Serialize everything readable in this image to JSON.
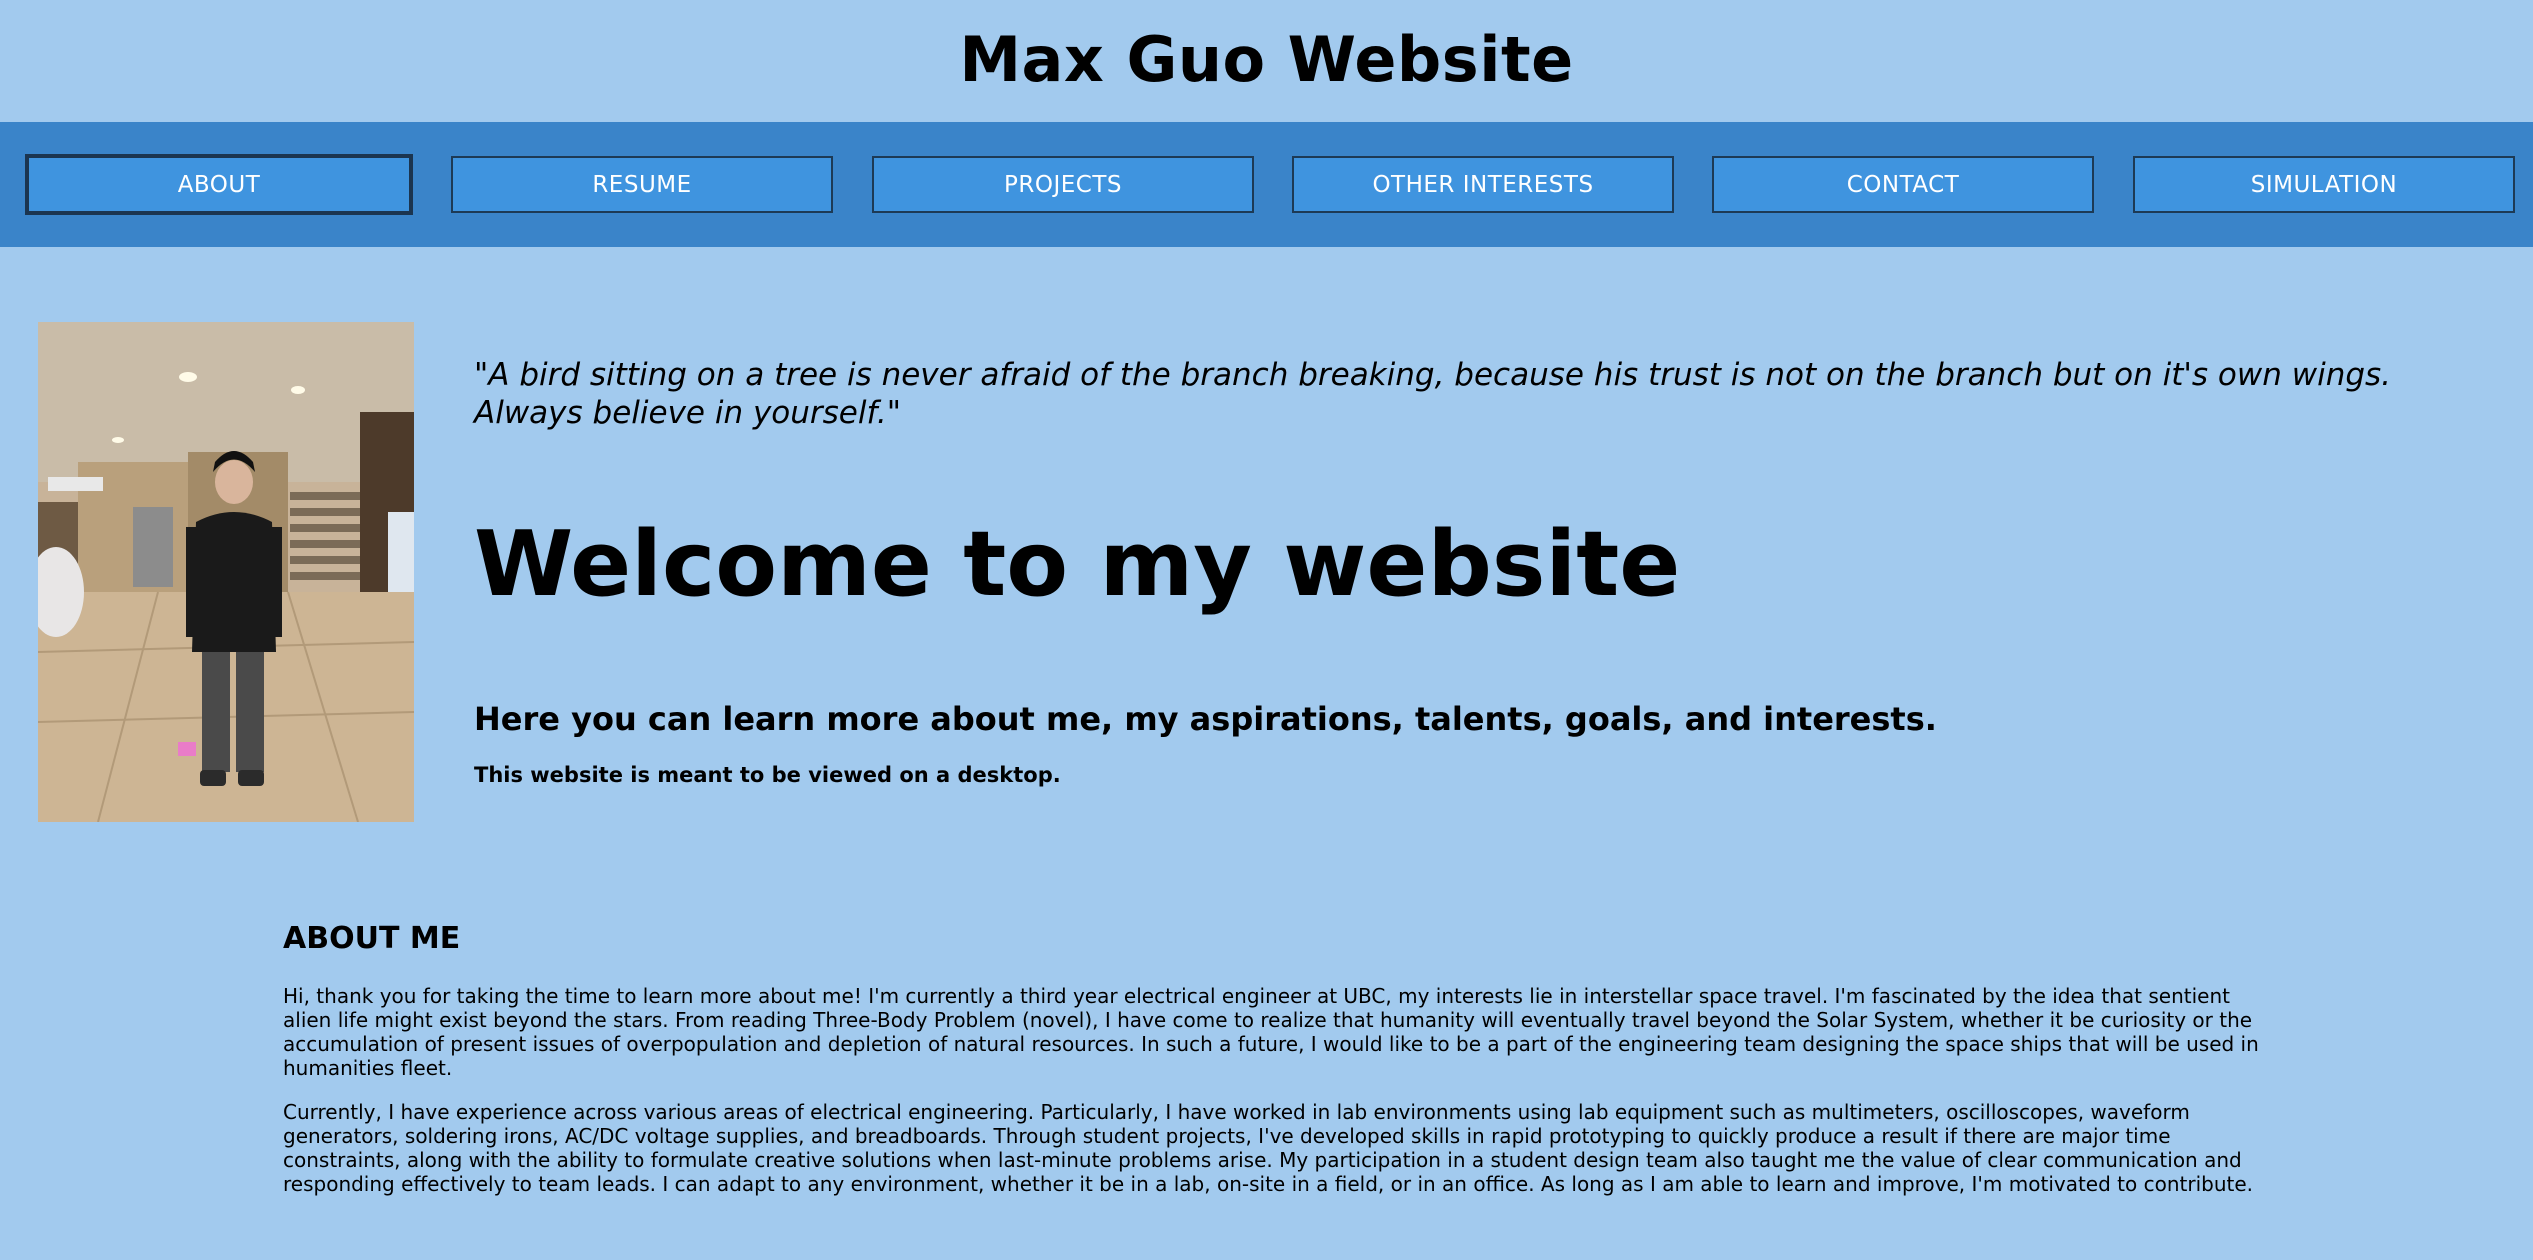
{
  "header": {
    "title": "Max Guo Website"
  },
  "nav": {
    "items": [
      {
        "label": "ABOUT"
      },
      {
        "label": "RESUME"
      },
      {
        "label": "PROJECTS"
      },
      {
        "label": "OTHER INTERESTS"
      },
      {
        "label": "CONTACT"
      },
      {
        "label": "SIMULATION"
      }
    ]
  },
  "hero": {
    "quote": "\"A bird sitting on a tree is never afraid of the branch breaking, because his trust is not on the branch but on it's own wings. Always believe in yourself.\"",
    "welcome": "Welcome to my website",
    "subheading": "Here you can learn more about me, my aspirations, talents, goals, and interests.",
    "note": "This website is meant to be viewed on a desktop."
  },
  "about": {
    "title": "ABOUT ME",
    "paragraphs": [
      "Hi, thank you for taking the time to learn more about me! I'm currently a third year electrical engineer at UBC, my interests lie in interstellar space travel. I'm fascinated by the idea that sentient alien life might exist beyond the stars. From reading Three-Body Problem (novel), I have come to realize that humanity will eventually travel beyond the Solar System, whether it be curiosity or the accumulation of present issues of overpopulation and depletion of natural resources. In such a future, I would like to be a part of the engineering team designing the space ships that will be used in humanities fleet.",
      "Currently, I have experience across various areas of electrical engineering. Particularly, I have worked in lab environments using lab equipment such as multimeters, oscilloscopes, waveform generators, soldering irons, AC/DC voltage supplies, and breadboards. Through student projects, I've developed skills in rapid prototyping to quickly produce a result if there are major time constraints, along with the ability to formulate creative solutions when last-minute problems arise. My participation in a student design team also taught me the value of clear communication and responding effectively to team leads. I can adapt to any environment, whether it be in a lab, on-site in a field, or in an office. As long as I am able to learn and improve, I'm motivated to contribute."
    ]
  },
  "colors": {
    "page_bg": "#a2caee",
    "nav_bg": "#3a84c9",
    "nav_button": "#3f94df"
  }
}
